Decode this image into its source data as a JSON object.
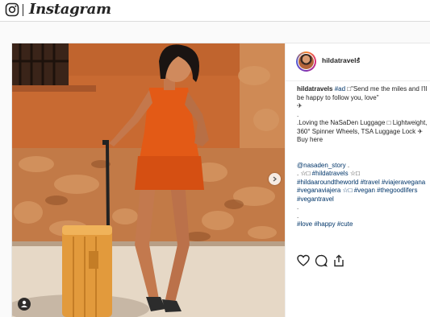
{
  "header": {
    "wordmark": "Instagram"
  },
  "post": {
    "username": "hildatravels",
    "follow_dot": "•",
    "caption": {
      "author": "hildatravels",
      "hashtag_ad": "#ad",
      "line1_text": " □\"Send me the miles and I'll be happy to follow you, love\"",
      "plane": "✈",
      "dot_a": ".",
      "loving": ".Loving the NaSaDen  Luggage □ Lightweight, 360° Spinner Wheels, TSA Luggage Lock ✈Buy here",
      "mention": "@nasaden_story",
      "mention_tail": " .",
      "tags_line_prefix": ". ☆□ ",
      "tag_hildatravels": "#hildatravels",
      "tags_line_suffix": " ☆□",
      "tags": "#hildaaroundtheworld #travel #viajeravegana #veganaviajera ☆□ #vegan #thegoodlifers #vegantravel",
      "dot_b": ".",
      "dot_c": ".",
      "tags_end": "#love #happy #cute"
    }
  },
  "colors": {
    "link": "#003569",
    "text": "#262626",
    "border": "#dbdbdb"
  },
  "icons": [
    "instagram-glyph-icon",
    "chevron-right-icon",
    "user-tag-icon",
    "heart-icon",
    "comment-icon",
    "share-icon"
  ]
}
